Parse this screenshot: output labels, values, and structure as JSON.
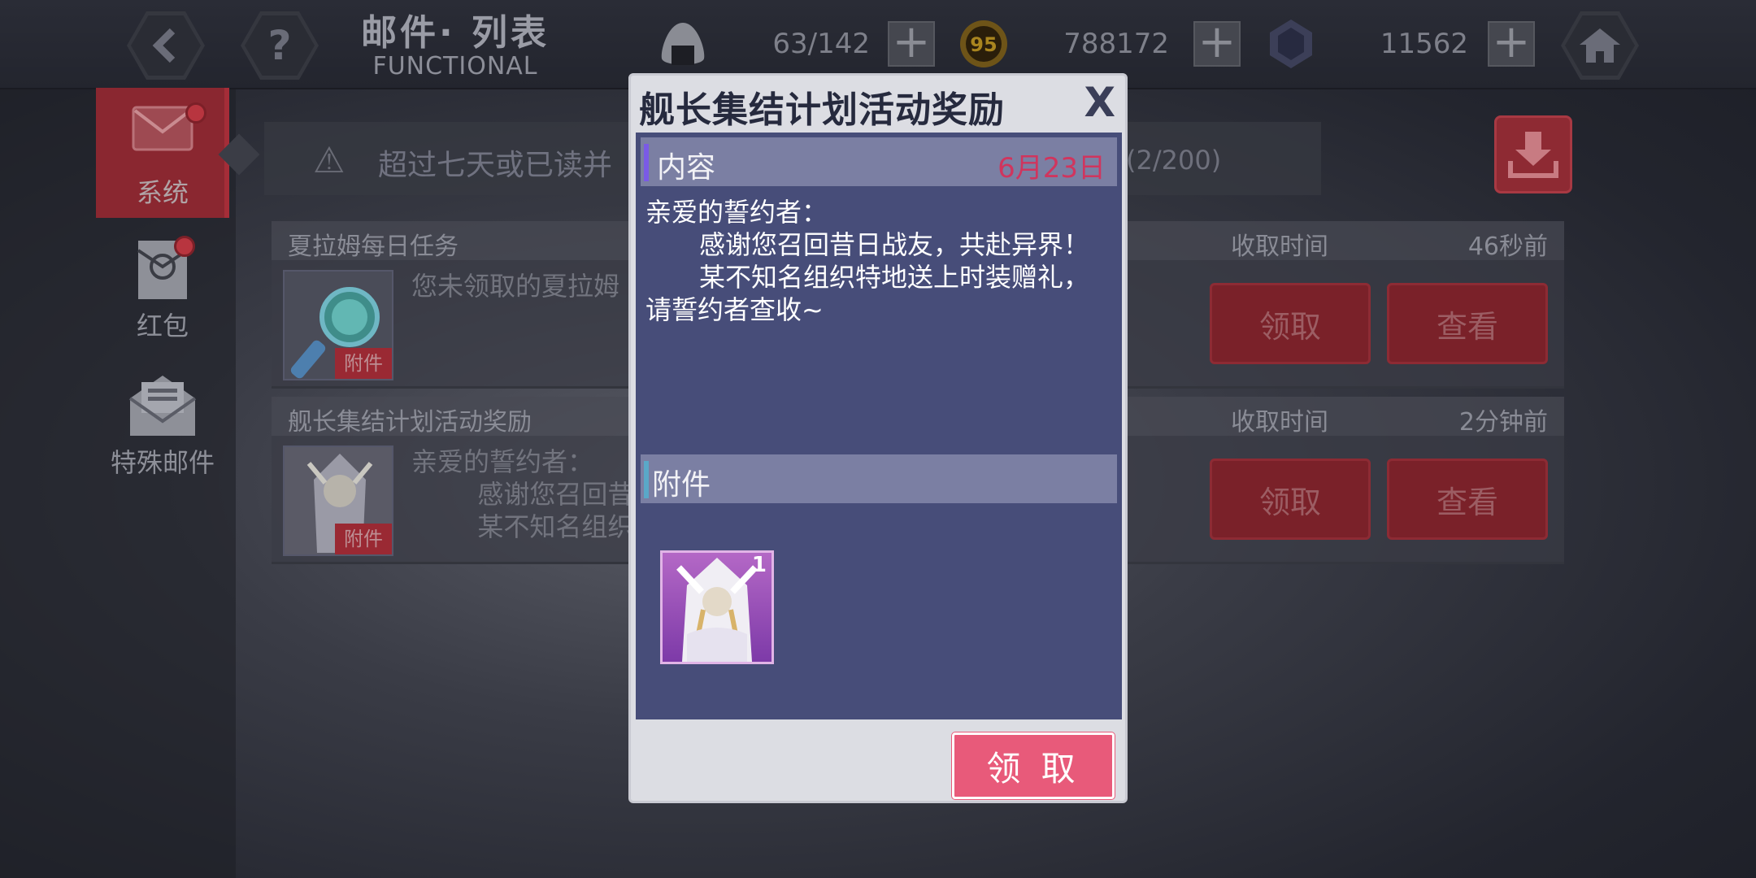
{
  "topbar": {
    "title": "邮件· 列表",
    "subtitle": "FUNCTIONAL",
    "stamina": "63/142",
    "coins": "788172",
    "crystals": "11562"
  },
  "sidebar": {
    "items": [
      {
        "label": "系统"
      },
      {
        "label": "红包"
      },
      {
        "label": "特殊邮件"
      }
    ]
  },
  "notice": {
    "text": "超过七天或已读并",
    "count": "(2/200)"
  },
  "mails": [
    {
      "subject": "夏拉姆每日任务",
      "recv_label": "收取时间",
      "ago": "46秒前",
      "preview": "您未领取的夏拉姆",
      "attach_tag": "附件",
      "claim": "领取",
      "view": "查看"
    },
    {
      "subject": "舰长集结计划活动奖励",
      "recv_label": "收取时间",
      "ago": "2分钟前",
      "preview": "亲爱的誓约者：\n        感谢您召回昔\n        某不知名组织",
      "attach_tag": "附件",
      "claim": "领取",
      "view": "查看"
    }
  ],
  "modal": {
    "title": "舰长集结计划活动奖励",
    "close": "X",
    "content_label": "内容",
    "date": "6月23日",
    "letter": {
      "line1": "亲爱的誓约者：",
      "line2": "感谢您召回昔日战友，共赴异界！",
      "line3": "某不知名组织特地送上时装赠礼，",
      "line4": "请誓约者查收~"
    },
    "attachment_label": "附件",
    "item_count": "1",
    "claim_button": "领 取"
  }
}
